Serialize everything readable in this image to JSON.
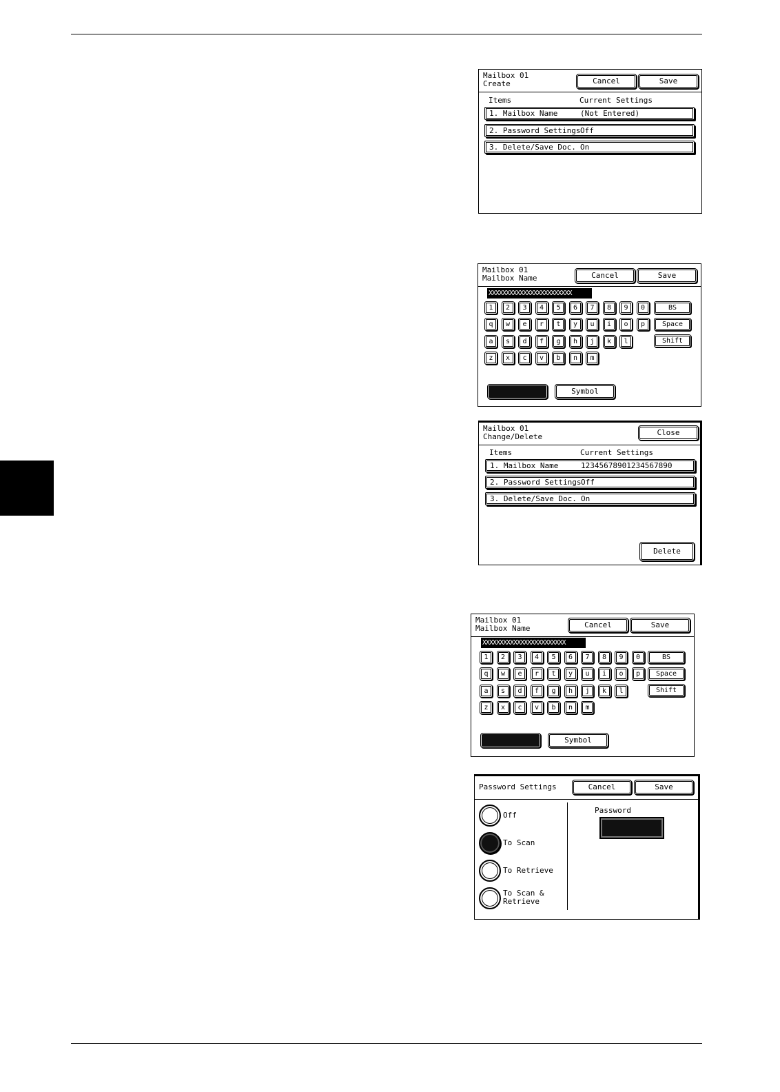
{
  "keyboard_rows": [
    [
      "1",
      "2",
      "3",
      "4",
      "5",
      "6",
      "7",
      "8",
      "9",
      "0"
    ],
    [
      "q",
      "w",
      "e",
      "r",
      "t",
      "y",
      "u",
      "i",
      "o",
      "p"
    ],
    [
      "a",
      "s",
      "d",
      "f",
      "g",
      "h",
      "j",
      "k",
      "l"
    ],
    [
      "z",
      "x",
      "c",
      "v",
      "b",
      "n",
      "m"
    ]
  ],
  "create_screen": {
    "title": "Mailbox 01\nCreate",
    "cancel_label": "Cancel",
    "save_label": "Save",
    "col_items": "Items",
    "col_current": "Current Settings",
    "rows": [
      {
        "item": "1. Mailbox Name",
        "value": "(Not Entered)"
      },
      {
        "item": "2. Password Settings",
        "value": "Off"
      },
      {
        "item": "3. Delete/Save Doc.",
        "value": "On"
      }
    ]
  },
  "name_screen_1": {
    "title": "Mailbox 01\nMailbox Name",
    "cancel_label": "Cancel",
    "save_label": "Save",
    "input_value": "XXXXXXXXXXXXXXXXXXXXXXXX",
    "bs_label": "BS",
    "space_label": "Space",
    "shift_label": "Shift",
    "symbol_label": "Symbol"
  },
  "change_screen": {
    "title": "Mailbox 01\nChange/Delete",
    "close_label": "Close",
    "col_items": "Items",
    "col_current": "Current Settings",
    "rows": [
      {
        "item": "1. Mailbox Name",
        "value": "12345678901234567890"
      },
      {
        "item": "2. Password Settings",
        "value": "Off"
      },
      {
        "item": "3. Delete/Save Doc.",
        "value": "On"
      }
    ],
    "delete_label": "Delete"
  },
  "name_screen_2": {
    "title": "Mailbox 01\nMailbox Name",
    "cancel_label": "Cancel",
    "save_label": "Save",
    "input_value": "XXXXXXXXXXXXXXXXXXXXXXXX",
    "bs_label": "BS",
    "space_label": "Space",
    "shift_label": "Shift",
    "symbol_label": "Symbol"
  },
  "password_screen": {
    "title": "Password Settings",
    "cancel_label": "Cancel",
    "save_label": "Save",
    "options": [
      {
        "label": "Off",
        "selected": false
      },
      {
        "label": "To Scan",
        "selected": true
      },
      {
        "label": "To Retrieve",
        "selected": false
      },
      {
        "label": "To Scan &\nRetrieve",
        "selected": false
      }
    ],
    "password_label": "Password"
  }
}
